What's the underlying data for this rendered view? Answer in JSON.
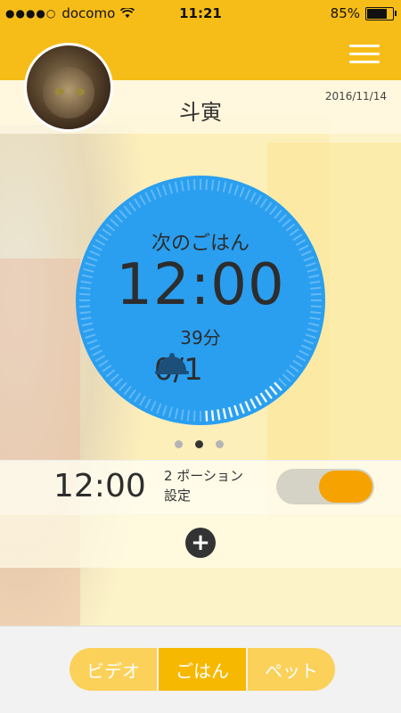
{
  "status": {
    "carrier": "docomo",
    "time": "11:21",
    "battery": "85%",
    "signal_icon": "signal-dots-icon",
    "wifi_icon": "wifi-icon"
  },
  "header": {
    "menu_icon": "hamburger-menu-icon"
  },
  "pet": {
    "name": "斗寅",
    "date": "2016/11/14"
  },
  "dial": {
    "label": "次のごはん",
    "time": "12:00",
    "remaining": "39分",
    "portions": "0/1",
    "bowl_icon": "cloche-icon",
    "accent": "#2a9ff0"
  },
  "pager": {
    "count": 3,
    "active": 1
  },
  "schedule": {
    "time": "12:00",
    "line1": "2 ポーション",
    "line2": "設定",
    "enabled": true
  },
  "add": {
    "icon": "plus-circle-icon"
  },
  "tabs": [
    {
      "label": "ビデオ"
    },
    {
      "label": "ごはん",
      "active": true
    },
    {
      "label": "ペット"
    }
  ],
  "colors": {
    "brand": "#f6bd18",
    "toggle_on": "#f6a200"
  }
}
